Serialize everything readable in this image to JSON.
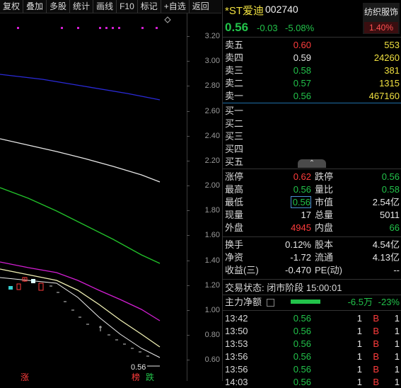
{
  "toolbar": {
    "buttons": [
      "复权",
      "叠加",
      "多股",
      "统计",
      "画线",
      "F10",
      "标记",
      "+自选",
      "返回"
    ]
  },
  "axis": {
    "ticks": [
      "3.20",
      "3.00",
      "2.80",
      "2.60",
      "2.40",
      "2.20",
      "2.00",
      "1.80",
      "1.60",
      "1.40",
      "1.20",
      "1.00",
      "0.80",
      "0.60"
    ]
  },
  "chart": {
    "last_price_label": "0.56",
    "badge_rise": "涨",
    "badge_list": "榜",
    "badge_fall": "跌"
  },
  "quote": {
    "name": "*ST爱迪",
    "code": "002740",
    "price": "0.56",
    "change": "-0.03",
    "change_pct": "-5.08%",
    "sector": "纺织服饰",
    "sector_pct": "1.40%"
  },
  "asks": [
    {
      "label": "卖五",
      "price": "0.60",
      "vol": "553"
    },
    {
      "label": "卖四",
      "price": "0.59",
      "vol": "24260"
    },
    {
      "label": "卖三",
      "price": "0.58",
      "vol": "381"
    },
    {
      "label": "卖二",
      "price": "0.57",
      "vol": "1315"
    },
    {
      "label": "卖一",
      "price": "0.56",
      "vol": "467160"
    }
  ],
  "bids": [
    {
      "label": "买一"
    },
    {
      "label": "买二"
    },
    {
      "label": "买三"
    },
    {
      "label": "买四"
    },
    {
      "label": "买五"
    }
  ],
  "stats": {
    "limit_up_label": "涨停",
    "limit_up": "0.62",
    "limit_down_label": "跌停",
    "limit_down": "0.56",
    "high_label": "最高",
    "high": "0.56",
    "vol_ratio_label": "量比",
    "vol_ratio": "0.58",
    "low_label": "最低",
    "low": "0.56",
    "mktcap_label": "市值",
    "mktcap": "2.54亿",
    "cur_vol_label": "现量",
    "cur_vol": "17",
    "total_vol_label": "总量",
    "total_vol": "5011",
    "outer_label": "外盘",
    "outer": "4945",
    "inner_label": "内盘",
    "inner": "66",
    "turnover_label": "换手",
    "turnover": "0.12%",
    "equity_label": "股本",
    "equity": "4.54亿",
    "nav_label": "净资",
    "nav": "-1.72",
    "float_label": "流通",
    "float": "4.13亿",
    "eps_label": "收益(三)",
    "eps": "-0.470",
    "pe_label": "PE(动)",
    "pe": "--"
  },
  "status": {
    "text": "交易状态: 闭市阶段 15:00:01",
    "mainflow_label": "主力净额",
    "mainflow_value": "-6.5万",
    "mainflow_pct": "-23%"
  },
  "ticks": [
    {
      "time": "13:42",
      "price": "0.56",
      "vol": "1",
      "side": "B",
      "n": "1"
    },
    {
      "time": "13:50",
      "price": "0.56",
      "vol": "1",
      "side": "B",
      "n": "1"
    },
    {
      "time": "13:53",
      "price": "0.56",
      "vol": "1",
      "side": "B",
      "n": "1"
    },
    {
      "time": "13:56",
      "price": "0.56",
      "vol": "1",
      "side": "B",
      "n": "1"
    },
    {
      "time": "13:56",
      "price": "0.56",
      "vol": "1",
      "side": "B",
      "n": "1"
    },
    {
      "time": "14:03",
      "price": "0.56",
      "vol": "1",
      "side": "B",
      "n": "1"
    }
  ],
  "colors": {
    "up": "#ff3c3c",
    "down": "#22c24a",
    "ma1": "#2a2ad8",
    "ma2": "#e6e6e6",
    "ma3": "#22c22a",
    "ma4": "#d21ed2",
    "ma5": "#f0f0b4"
  }
}
